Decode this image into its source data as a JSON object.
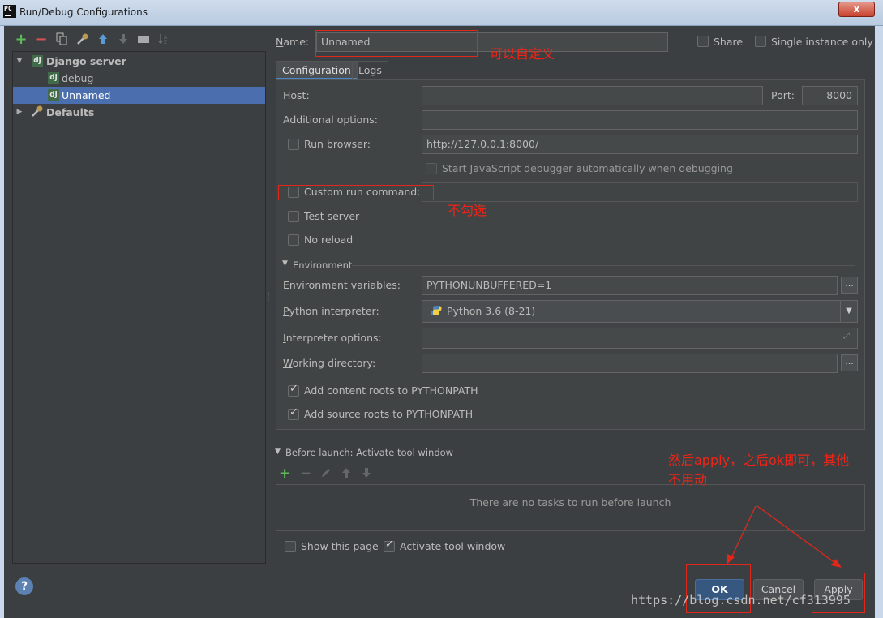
{
  "window": {
    "title": "Run/Debug Configurations",
    "app_icon_text": "PC",
    "close_label": "x"
  },
  "left_toolbar": {
    "icons": [
      "add-icon",
      "remove-icon",
      "copy-icon",
      "wrench-icon",
      "move-up-icon",
      "move-down-icon",
      "folder-icon",
      "sort-icon"
    ]
  },
  "tree": {
    "items": [
      {
        "label": "Django server",
        "icon": "dj",
        "level": 0,
        "expanded": true,
        "bold": true
      },
      {
        "label": "debug",
        "icon": "dj",
        "level": 1
      },
      {
        "label": "Unnamed",
        "icon": "dj",
        "level": 1,
        "selected": true
      },
      {
        "label": "Defaults",
        "icon": "wrench",
        "level": 0,
        "expanded": false,
        "bold": true
      }
    ]
  },
  "header": {
    "name_label": "Name:",
    "name_value": "Unnamed",
    "share_label": "Share",
    "single_instance_label": "Single instance only"
  },
  "tabs": [
    {
      "label": "Configuration",
      "active": true
    },
    {
      "label": "Logs",
      "active": false
    }
  ],
  "config": {
    "host_label": "Host:",
    "host_value": "",
    "port_label": "Port:",
    "port_value": "8000",
    "additional_options_label": "Additional options:",
    "additional_options_value": "",
    "run_browser_label": "Run browser:",
    "run_browser_url": "http://127.0.0.1:8000/",
    "js_debugger_label": "Start JavaScript debugger automatically when debugging",
    "custom_run_command_label": "Custom run command:",
    "test_server_label": "Test server",
    "no_reload_label": "No reload",
    "environment_section": "Environment",
    "env_vars_label": "Environment variables:",
    "env_vars_value": "PYTHONUNBUFFERED=1",
    "python_interpreter_label": "Python interpreter:",
    "python_interpreter_value": "Python 3.6 (8-21)",
    "interpreter_options_label": "Interpreter options:",
    "working_directory_label": "Working directory:",
    "add_content_roots_label": "Add content roots to PYTHONPATH",
    "add_source_roots_label": "Add source roots to PYTHONPATH",
    "browse_label": "..."
  },
  "before_launch": {
    "section_label": "Before launch: Activate tool window",
    "empty_text": "There are no tasks to run before launch",
    "show_this_page_label": "Show this page",
    "activate_tool_window_label": "Activate tool window"
  },
  "buttons": {
    "ok": "OK",
    "cancel": "Cancel",
    "apply": "Apply"
  },
  "annotations": {
    "name_note": "可以自定义",
    "custom_cmd_note": "不勾选",
    "apply_note_line1": "然后apply，之后ok即可，其他",
    "apply_note_line2": "不用动"
  },
  "watermark": "https://blog.csdn.net/cf313995",
  "colors": {
    "background": "#3c3f41",
    "selection": "#4b6eaf",
    "annotation_red": "#f02416",
    "default_button": "#365880"
  }
}
